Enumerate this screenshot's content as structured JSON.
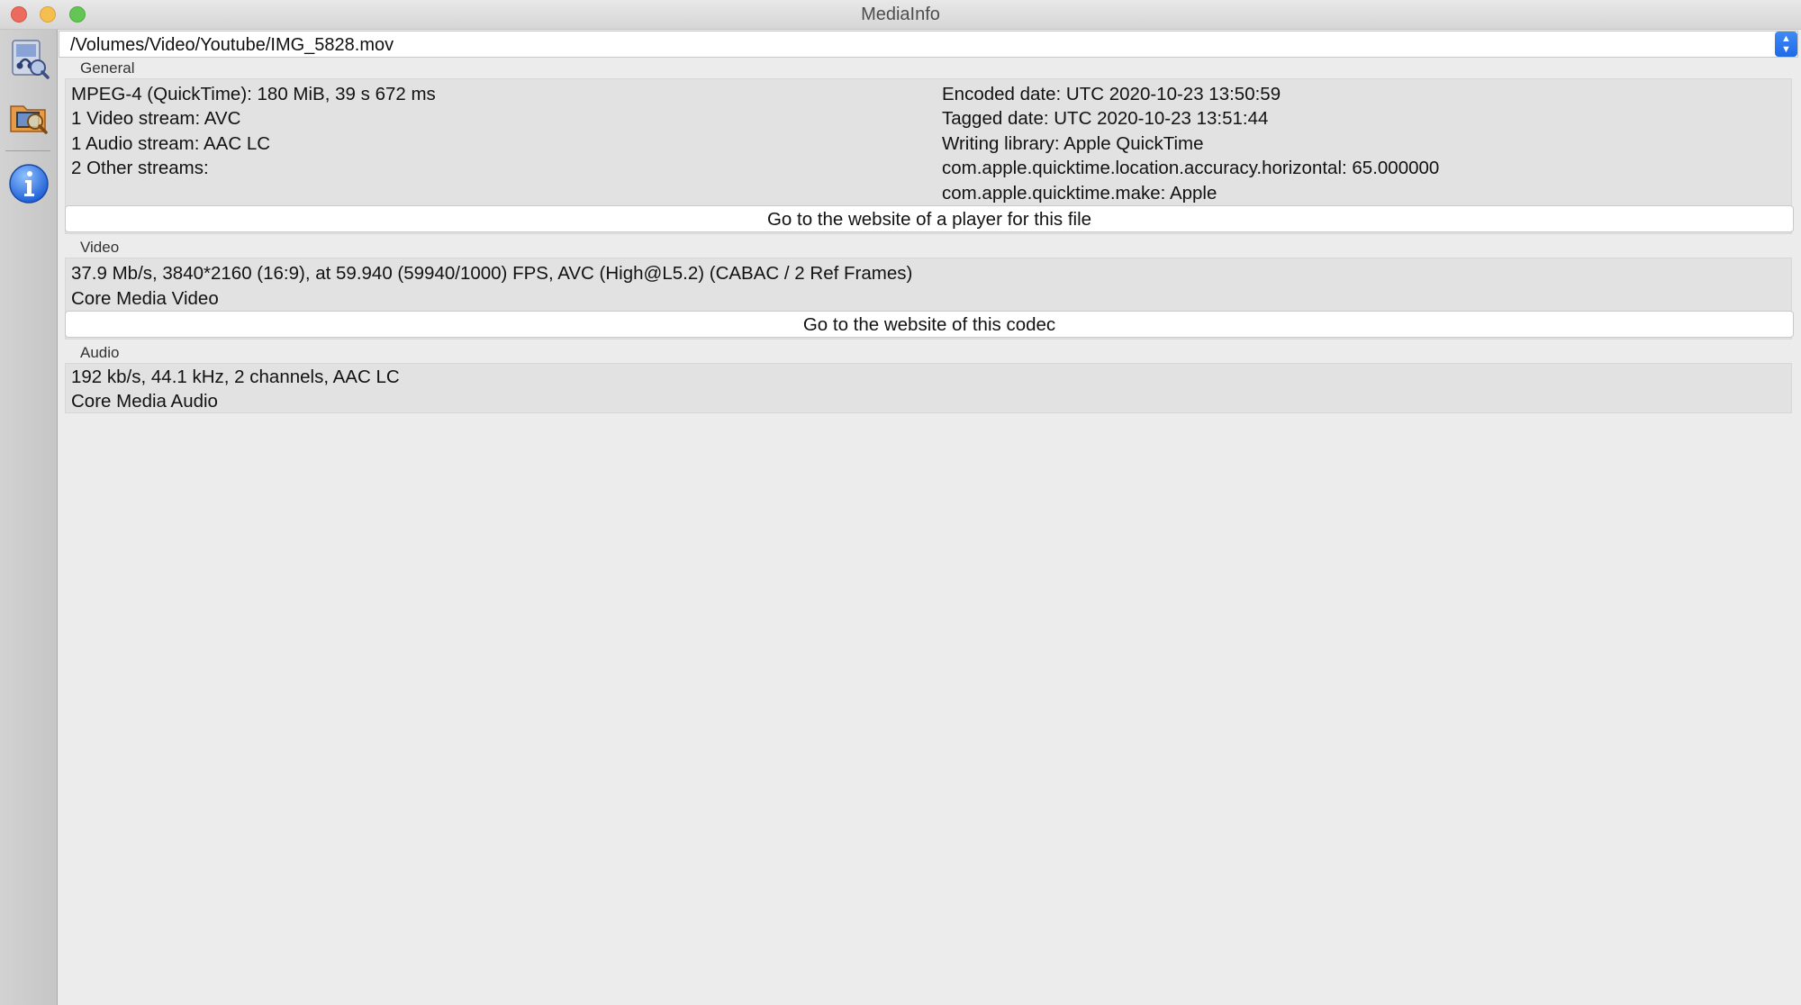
{
  "window": {
    "title": "MediaInfo"
  },
  "sidebar": {
    "items": [
      {
        "icon": "open-file-icon"
      },
      {
        "icon": "open-folder-icon"
      },
      {
        "icon": "info-icon"
      }
    ]
  },
  "path_combo": {
    "value": "/Volumes/Video/Youtube/IMG_5828.mov"
  },
  "general": {
    "title": "General",
    "left_lines": [
      "MPEG-4 (QuickTime): 180 MiB, 39 s 672 ms",
      "1 Video stream: AVC",
      "1 Audio stream: AAC LC",
      "2 Other streams:"
    ],
    "right_lines": [
      "Encoded date: UTC 2020-10-23 13:50:59",
      "Tagged date: UTC 2020-10-23 13:51:44",
      "Writing library: Apple QuickTime",
      "com.apple.quicktime.location.accuracy.horizontal: 65.000000",
      "com.apple.quicktime.make: Apple"
    ],
    "button_label": "Go to the website of a player for this file"
  },
  "video": {
    "title": "Video",
    "lines": [
      "37.9 Mb/s, 3840*2160 (16:9), at 59.940 (59940/1000) FPS, AVC (High@L5.2) (CABAC / 2 Ref Frames)",
      "Core Media Video"
    ],
    "button_label": "Go to the website of this codec"
  },
  "audio": {
    "title": "Audio",
    "lines": [
      "192 kb/s, 44.1 kHz, 2 channels, AAC LC",
      "Core Media Audio"
    ]
  },
  "colors": {
    "accent": "#2a76ee",
    "window_bg": "#ececec"
  }
}
